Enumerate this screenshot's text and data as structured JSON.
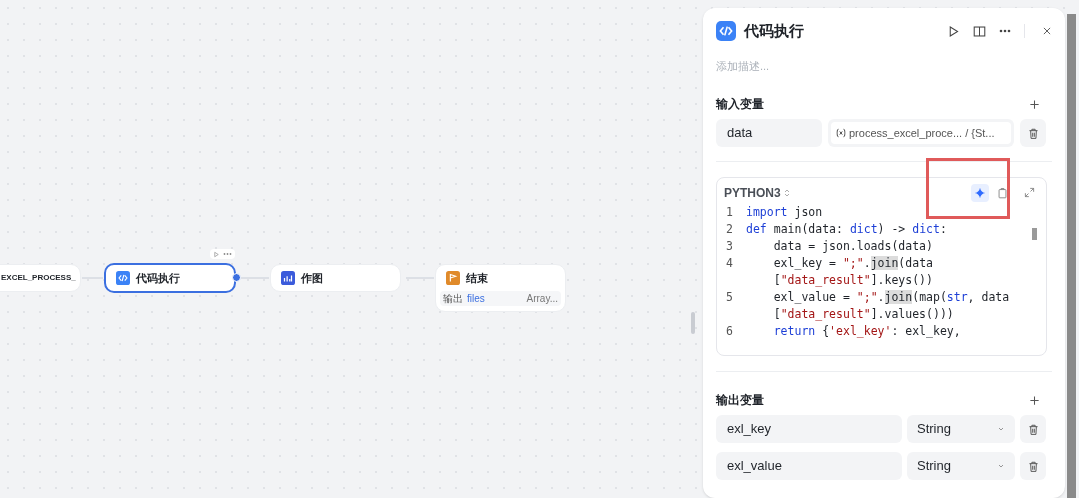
{
  "canvas": {
    "nodes": [
      {
        "kind": "plain",
        "title": "EXCEL_PROCESS_",
        "selected": false
      },
      {
        "kind": "code",
        "title": "代码执行",
        "selected": true
      },
      {
        "kind": "chart",
        "title": "作图",
        "selected": false
      },
      {
        "kind": "end",
        "title": "结束",
        "selected": false,
        "output": {
          "label": "输出",
          "name": "files",
          "type": "Array..."
        }
      }
    ]
  },
  "panel": {
    "title": "代码执行",
    "description_placeholder": "添加描述...",
    "input_section": "输入变量",
    "inputs": [
      {
        "name": "data",
        "reference": "process_excel_proce... / {St..."
      }
    ],
    "editor": {
      "language": "PYTHON3",
      "lines": [
        {
          "no": "1",
          "tokens": [
            {
              "kind": "kw",
              "t": "import"
            },
            {
              "kind": "plain",
              "t": " json"
            }
          ]
        },
        {
          "no": "2",
          "tokens": [
            {
              "kind": "kw",
              "t": "def"
            },
            {
              "kind": "plain",
              "t": " main(data: "
            },
            {
              "kind": "kw",
              "t": "dict"
            },
            {
              "kind": "plain",
              "t": ") -> "
            },
            {
              "kind": "kw",
              "t": "dict"
            },
            {
              "kind": "plain",
              "t": ":"
            }
          ]
        },
        {
          "no": "3",
          "tokens": [
            {
              "kind": "plain",
              "t": "    data = json.loads(data)"
            }
          ]
        },
        {
          "no": "4",
          "tokens": [
            {
              "kind": "plain",
              "t": "    exl_key = "
            },
            {
              "kind": "str",
              "t": "\";\""
            },
            {
              "kind": "plain",
              "t": "."
            },
            {
              "kind": "hl",
              "t": "join"
            },
            {
              "kind": "plain",
              "t": "(data"
            }
          ]
        },
        {
          "tokens": [
            {
              "kind": "plain",
              "t": "    ["
            },
            {
              "kind": "str",
              "t": "\"data_result\""
            },
            {
              "kind": "plain",
              "t": "].keys())"
            }
          ]
        },
        {
          "no": "5",
          "tokens": [
            {
              "kind": "plain",
              "t": "    exl_value = "
            },
            {
              "kind": "str",
              "t": "\";\""
            },
            {
              "kind": "plain",
              "t": "."
            },
            {
              "kind": "hl",
              "t": "join"
            },
            {
              "kind": "plain",
              "t": "(map("
            },
            {
              "kind": "kw",
              "t": "str"
            },
            {
              "kind": "plain",
              "t": ", data"
            }
          ]
        },
        {
          "tokens": [
            {
              "kind": "plain",
              "t": "    ["
            },
            {
              "kind": "str",
              "t": "\"data_result\""
            },
            {
              "kind": "plain",
              "t": "].values()))"
            }
          ]
        },
        {
          "no": "6",
          "tokens": [
            {
              "kind": "kw",
              "t": "    return"
            },
            {
              "kind": "plain",
              "t": " {"
            },
            {
              "kind": "str",
              "t": "'exl_key'"
            },
            {
              "kind": "plain",
              "t": ": exl_key,"
            }
          ]
        }
      ]
    },
    "output_section": "输出变量",
    "outputs": [
      {
        "name": "exl_key",
        "type": "String"
      },
      {
        "name": "exl_value",
        "type": "String"
      }
    ]
  }
}
